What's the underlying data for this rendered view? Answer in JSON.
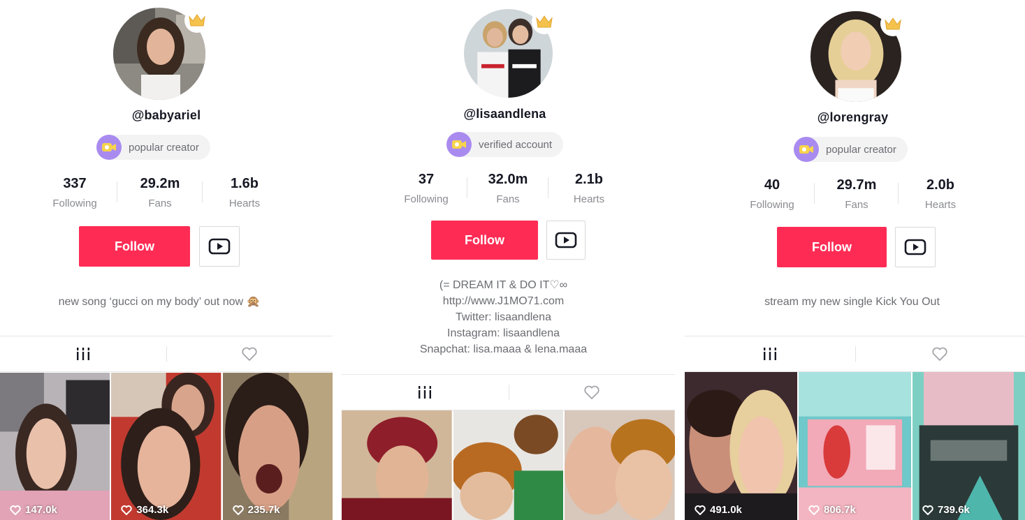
{
  "colors": {
    "follow_bg": "#fe2c55",
    "badge_icon_bg": "#a98bf0",
    "crown": "#f5c24d"
  },
  "icons": {
    "crown": "crown-icon",
    "badge": "video-camera-icon",
    "youtube": "youtube-play-icon",
    "videos_tab": "grid-bars-icon",
    "liked_tab": "heart-outline-icon",
    "likes": "heart-icon"
  },
  "profiles": [
    {
      "username": "@babyariel",
      "badge": "popular creator",
      "stats": [
        {
          "value": "337",
          "label": "Following"
        },
        {
          "value": "29.2m",
          "label": "Fans"
        },
        {
          "value": "1.6b",
          "label": "Hearts"
        }
      ],
      "follow_label": "Follow",
      "bio": [
        "new song ‘gucci on my body’ out now 🙊"
      ],
      "videos": [
        {
          "likes": "147.0k"
        },
        {
          "likes": "364.3k"
        },
        {
          "likes": "235.7k"
        }
      ]
    },
    {
      "username": "@lisaandlena",
      "badge": "verified account",
      "stats": [
        {
          "value": "37",
          "label": "Following"
        },
        {
          "value": "32.0m",
          "label": "Fans"
        },
        {
          "value": "2.1b",
          "label": "Hearts"
        }
      ],
      "follow_label": "Follow",
      "bio": [
        "(=  DREAM IT & DO IT♡∞",
        "http://www.J1MO71.com",
        "Twitter: lisaandlena",
        "Instagram: lisaandlena",
        "Snapchat: lisa.maaa & lena.maaa"
      ],
      "videos": [
        {
          "likes": ""
        },
        {
          "likes": ""
        },
        {
          "likes": ""
        }
      ]
    },
    {
      "username": "@lorengray",
      "badge": "popular creator",
      "stats": [
        {
          "value": "40",
          "label": "Following"
        },
        {
          "value": "29.7m",
          "label": "Fans"
        },
        {
          "value": "2.0b",
          "label": "Hearts"
        }
      ],
      "follow_label": "Follow",
      "bio": [
        "stream my new single Kick You Out"
      ],
      "videos": [
        {
          "likes": "491.0k"
        },
        {
          "likes": "806.7k"
        },
        {
          "likes": "739.6k"
        }
      ]
    }
  ]
}
